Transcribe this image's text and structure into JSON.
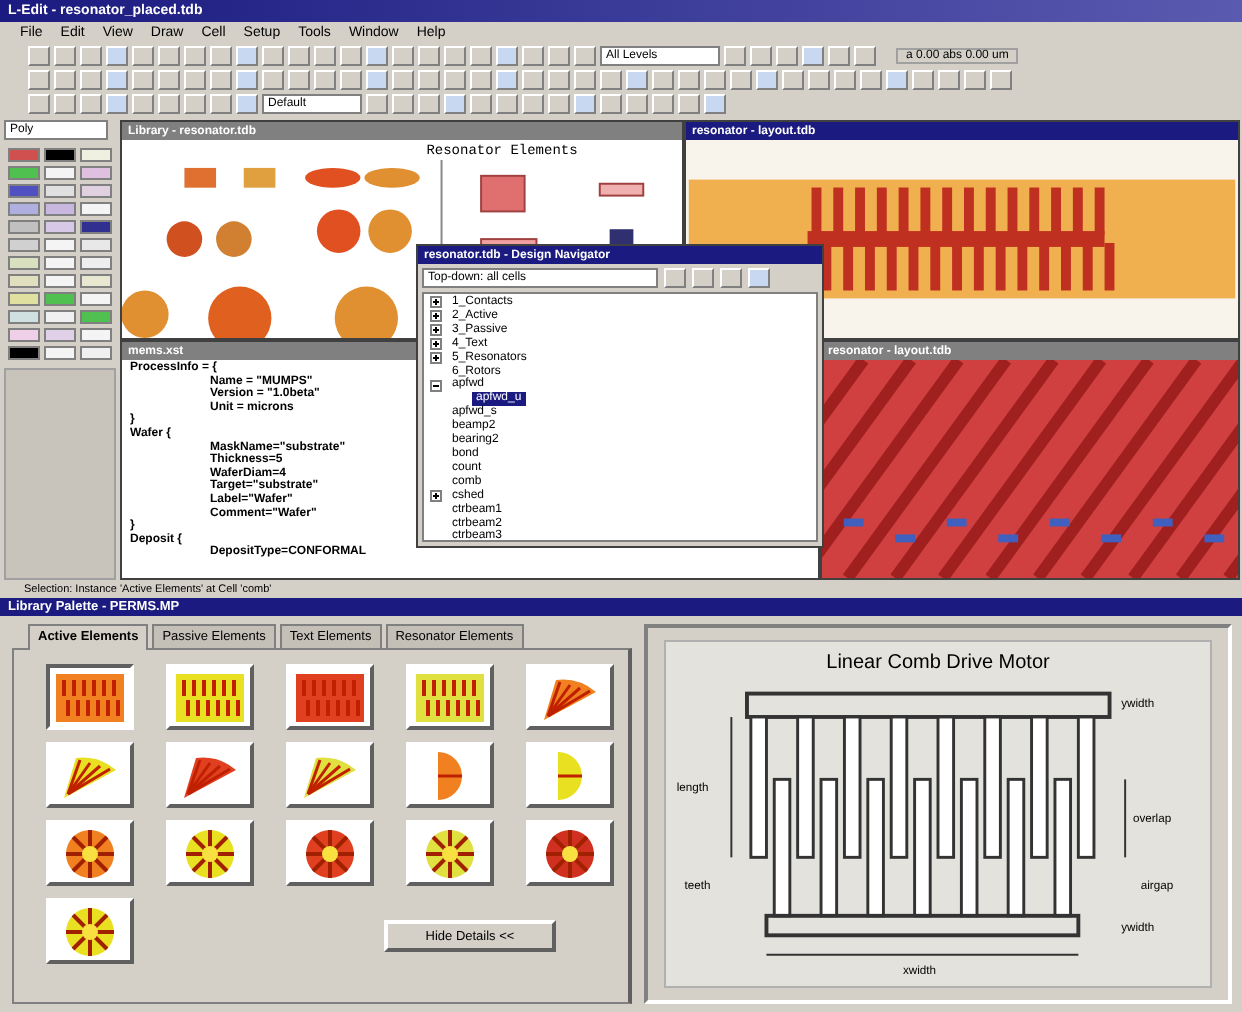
{
  "window": {
    "title": "L-Edit - resonator_placed.tdb"
  },
  "menu": [
    "File",
    "Edit",
    "View",
    "Draw",
    "Cell",
    "Setup",
    "Tools",
    "Window",
    "Help"
  ],
  "toolbar": {
    "level_select": "All Levels",
    "style_select": "Default",
    "readout": "a 0.00 abs 0.00 um"
  },
  "layer_palette": {
    "select": "Poly",
    "swatches": [
      {
        "color": "#d05050"
      },
      {
        "color": "#000000"
      },
      {
        "color": "#f0f0e0"
      },
      {
        "color": "#50c050"
      },
      {
        "color": "#f4f4f4"
      },
      {
        "color": "#e0c0e0"
      },
      {
        "color": "#5050c0"
      },
      {
        "color": "#e0e0e0"
      },
      {
        "color": "#e0d0e0"
      },
      {
        "color": "#b0b0e0"
      },
      {
        "color": "#c8b8e0"
      },
      {
        "color": "#f4f4f4"
      },
      {
        "color": "#c0c0c0"
      },
      {
        "color": "#d8c8e8"
      },
      {
        "color": "#303090"
      },
      {
        "color": "#d0d0d0"
      },
      {
        "color": "#f4f4f4"
      },
      {
        "color": "#e8e8e8"
      },
      {
        "color": "#d8e0c0"
      },
      {
        "color": "#f4f4f4"
      },
      {
        "color": "#eeeeee"
      },
      {
        "color": "#e0e0c0"
      },
      {
        "color": "#f4f4f4"
      },
      {
        "color": "#e8e8d0"
      },
      {
        "color": "#e0e0a0"
      },
      {
        "color": "#50c050"
      },
      {
        "color": "#f4f4f4"
      },
      {
        "color": "#d0e0e0"
      },
      {
        "color": "#f0f0f0"
      },
      {
        "color": "#50c050"
      },
      {
        "color": "#f0d0e8"
      },
      {
        "color": "#e0d0e8"
      },
      {
        "color": "#f4f4f4"
      },
      {
        "color": "#000000"
      },
      {
        "color": "#f4f4f4"
      },
      {
        "color": "#f0f0f0"
      }
    ]
  },
  "layout_window": {
    "title": "Library - resonator.tdb",
    "heading": "Resonator Elements"
  },
  "view_window": {
    "title": "resonator - layout.tdb"
  },
  "view3d_window": {
    "title": "resonator - layout.tdb"
  },
  "text_window": {
    "title": "mems.xst",
    "blocks": [
      {
        "header": "ProcessInfo = {",
        "lines": [
          "Name = \"MUMPS\"",
          "Version = \"1.0beta\"",
          "Unit = microns"
        ],
        "close": "}"
      },
      {
        "header": "Wafer {",
        "lines": [
          "MaskName=\"substrate\"",
          "Thickness=5",
          "WaferDiam=4",
          "Target=\"substrate\"",
          "Label=\"Wafer\"",
          "Comment=\"Wafer\""
        ],
        "close": "}"
      },
      {
        "header": "Deposit {",
        "lines": [
          "DepositType=CONFORMAL"
        ]
      }
    ]
  },
  "navigator": {
    "title": "resonator.tdb - Design Navigator",
    "filter": "Top-down: all cells",
    "items": [
      {
        "label": "1_Contacts",
        "expandable": true,
        "selected": false
      },
      {
        "label": "2_Active",
        "expandable": true,
        "selected": false
      },
      {
        "label": "3_Passive",
        "expandable": true,
        "selected": false
      },
      {
        "label": "4_Text",
        "expandable": true,
        "selected": false
      },
      {
        "label": "5_Resonators",
        "expandable": true,
        "selected": false
      },
      {
        "label": "6_Rotors",
        "expandable": false,
        "selected": false
      },
      {
        "label": "apfwd",
        "expandable": true,
        "selected": false,
        "children": [
          {
            "label": "apfwd_u",
            "expandable": false,
            "selected": true
          }
        ]
      },
      {
        "label": "apfwd_s",
        "expandable": false,
        "selected": false
      },
      {
        "label": "beamp2",
        "expandable": false,
        "selected": false
      },
      {
        "label": "bearing2",
        "expandable": false,
        "selected": false
      },
      {
        "label": "bond",
        "expandable": false,
        "selected": false
      },
      {
        "label": "count",
        "expandable": false,
        "selected": false
      },
      {
        "label": "comb",
        "expandable": false,
        "selected": false
      },
      {
        "label": "cshed",
        "expandable": true,
        "selected": false
      },
      {
        "label": "ctrbeam1",
        "expandable": false,
        "selected": false
      },
      {
        "label": "ctrbeam2",
        "expandable": false,
        "selected": false
      },
      {
        "label": "ctrbeam3",
        "expandable": false,
        "selected": false
      }
    ]
  },
  "status_text": "Selection: Instance 'Active Elements' at Cell 'comb'",
  "library": {
    "title": "Library Palette - PERMS.MP",
    "tabs": [
      {
        "label": "Active Elements",
        "selected": true
      },
      {
        "label": "Passive Elements",
        "selected": false
      },
      {
        "label": "Text Elements",
        "selected": false
      },
      {
        "label": "Resonator Elements",
        "selected": false
      }
    ],
    "elements": [
      {
        "kind": "comb",
        "color": "#f08020",
        "selected": true
      },
      {
        "kind": "comb",
        "color": "#e8e020",
        "selected": false
      },
      {
        "kind": "comb",
        "color": "#e04020",
        "selected": false
      },
      {
        "kind": "comb",
        "color": "#e0e040",
        "selected": false
      },
      {
        "kind": "fan",
        "color": "#f08020",
        "selected": false
      },
      {
        "kind": "fan",
        "color": "#e8e020",
        "selected": false
      },
      {
        "kind": "fan",
        "color": "#e04020",
        "selected": false
      },
      {
        "kind": "fan",
        "color": "#e0e040",
        "selected": false
      },
      {
        "kind": "half",
        "color": "#f08020",
        "selected": false
      },
      {
        "kind": "half",
        "color": "#e8e020",
        "selected": false
      },
      {
        "kind": "rotor",
        "color": "#f08020",
        "selected": false
      },
      {
        "kind": "rotor",
        "color": "#e8e020",
        "selected": false
      },
      {
        "kind": "rotor",
        "color": "#e04020",
        "selected": false
      },
      {
        "kind": "rotor",
        "color": "#e0e040",
        "selected": false
      },
      {
        "kind": "rotor",
        "color": "#d03020",
        "selected": false
      },
      {
        "kind": "rotor",
        "color": "#e8e020",
        "selected": false
      }
    ],
    "button": "Hide Details <<",
    "detail": {
      "title": "Linear Comb Drive Motor",
      "labels": [
        "ywidth",
        "length",
        "overlap",
        "teeth",
        "airgap",
        "ywidth",
        "xwidth"
      ]
    }
  }
}
